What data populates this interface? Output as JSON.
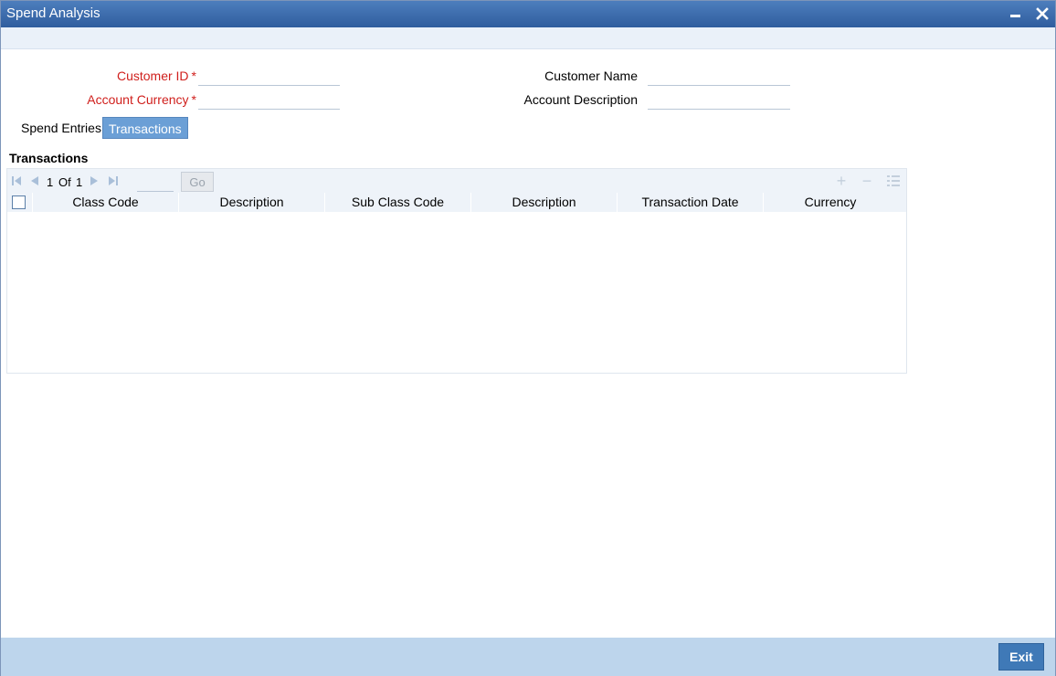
{
  "window": {
    "title": "Spend Analysis"
  },
  "form": {
    "customer_id": {
      "label": "Customer ID",
      "required_mark": "*",
      "value": ""
    },
    "account_currency": {
      "label": "Account Currency",
      "required_mark": "*",
      "value": ""
    },
    "customer_name": {
      "label": "Customer Name",
      "value": ""
    },
    "account_description": {
      "label": "Account Description",
      "value": ""
    }
  },
  "tabs": [
    {
      "label": "Spend Entries",
      "active": false
    },
    {
      "label": "Transactions",
      "active": true
    }
  ],
  "section": {
    "title": "Transactions"
  },
  "pager": {
    "current": "1",
    "of_label": "Of",
    "total": "1",
    "go_label": "Go"
  },
  "grid": {
    "columns": [
      "Class Code",
      "Description",
      "Sub Class Code",
      "Description",
      "Transaction Date",
      "Currency"
    ],
    "rows": []
  },
  "footer": {
    "exit_label": "Exit"
  },
  "colors": {
    "title_bar": "#2f5d9e",
    "required": "#d0201d",
    "active_tab": "#6b9fd6",
    "footer": "#bdd5ec",
    "exit_button": "#3f79b7"
  }
}
